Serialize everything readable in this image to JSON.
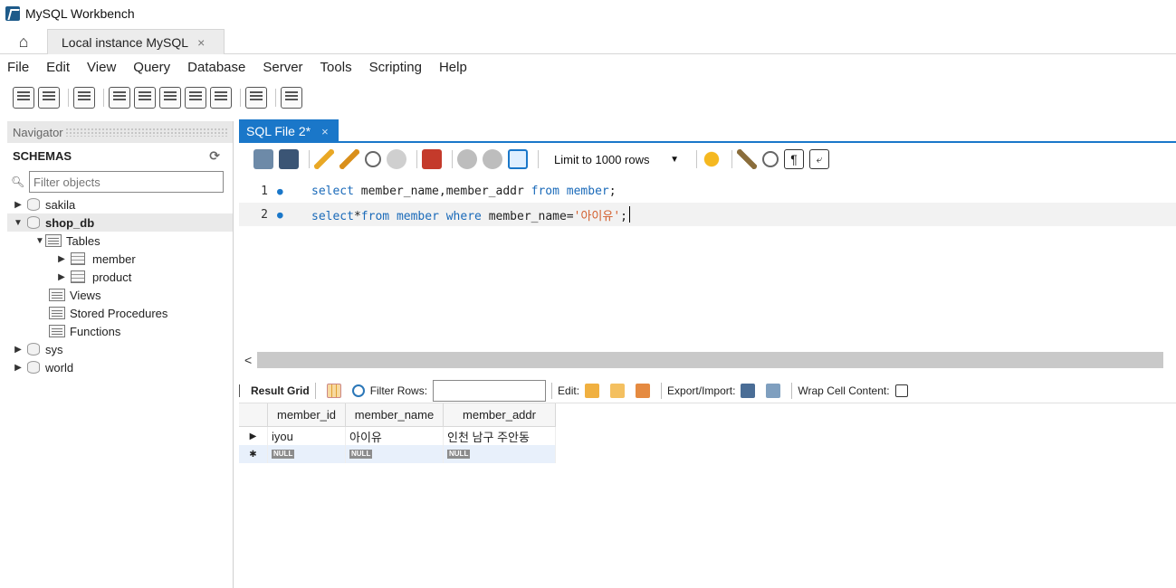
{
  "window": {
    "title": "MySQL Workbench"
  },
  "tabs": {
    "connection_label": "Local instance MySQL",
    "close_glyph": "×"
  },
  "menu": [
    "File",
    "Edit",
    "View",
    "Query",
    "Database",
    "Server",
    "Tools",
    "Scripting",
    "Help"
  ],
  "navigator": {
    "header": "Navigator",
    "schemas_label": "SCHEMAS",
    "filter_placeholder": "Filter objects",
    "tree": [
      {
        "label": "sakila",
        "level": 0,
        "kind": "schema",
        "expanded": false,
        "bold": false
      },
      {
        "label": "shop_db",
        "level": 0,
        "kind": "schema",
        "expanded": true,
        "bold": true
      },
      {
        "label": "Tables",
        "level": 1,
        "kind": "folder",
        "expanded": true
      },
      {
        "label": "member",
        "level": 2,
        "kind": "table",
        "expanded": false
      },
      {
        "label": "product",
        "level": 2,
        "kind": "table",
        "expanded": false
      },
      {
        "label": "Views",
        "level": 1,
        "kind": "folder"
      },
      {
        "label": "Stored Procedures",
        "level": 1,
        "kind": "folder"
      },
      {
        "label": "Functions",
        "level": 1,
        "kind": "folder"
      },
      {
        "label": "sys",
        "level": 0,
        "kind": "schema",
        "expanded": false
      },
      {
        "label": "world",
        "level": 0,
        "kind": "schema",
        "expanded": false
      }
    ]
  },
  "editor": {
    "file_tab": "SQL File 2*",
    "limit_label": "Limit to 1000 rows",
    "lines": [
      {
        "number": "1",
        "parts": [
          {
            "t": "select",
            "c": "kw"
          },
          {
            "t": " member_name,member_addr ",
            "c": ""
          },
          {
            "t": "from",
            "c": "kw"
          },
          {
            "t": " ",
            "c": ""
          },
          {
            "t": "member",
            "c": "kw"
          },
          {
            "t": ";",
            "c": ""
          }
        ]
      },
      {
        "number": "2",
        "parts": [
          {
            "t": "select",
            "c": "kw"
          },
          {
            "t": "*",
            "c": ""
          },
          {
            "t": "from",
            "c": "kw"
          },
          {
            "t": " ",
            "c": ""
          },
          {
            "t": "member",
            "c": "kw"
          },
          {
            "t": " ",
            "c": ""
          },
          {
            "t": "where",
            "c": "kw"
          },
          {
            "t": " member_name=",
            "c": ""
          },
          {
            "t": "'아이유'",
            "c": "str"
          },
          {
            "t": ";",
            "c": ""
          }
        ]
      }
    ]
  },
  "results": {
    "tab_label": "Result Grid",
    "filter_label": "Filter Rows:",
    "edit_label": "Edit:",
    "export_label": "Export/Import:",
    "wrap_label": "Wrap Cell Content:",
    "columns": [
      "member_id",
      "member_name",
      "member_addr"
    ],
    "rows": [
      [
        "iyou",
        "아이유",
        "인천 남구 주안동"
      ]
    ],
    "null_label": "NULL"
  },
  "colors": {
    "accent": "#1a77c9",
    "keyword": "#1a6ab9",
    "string": "#d35d2b"
  }
}
